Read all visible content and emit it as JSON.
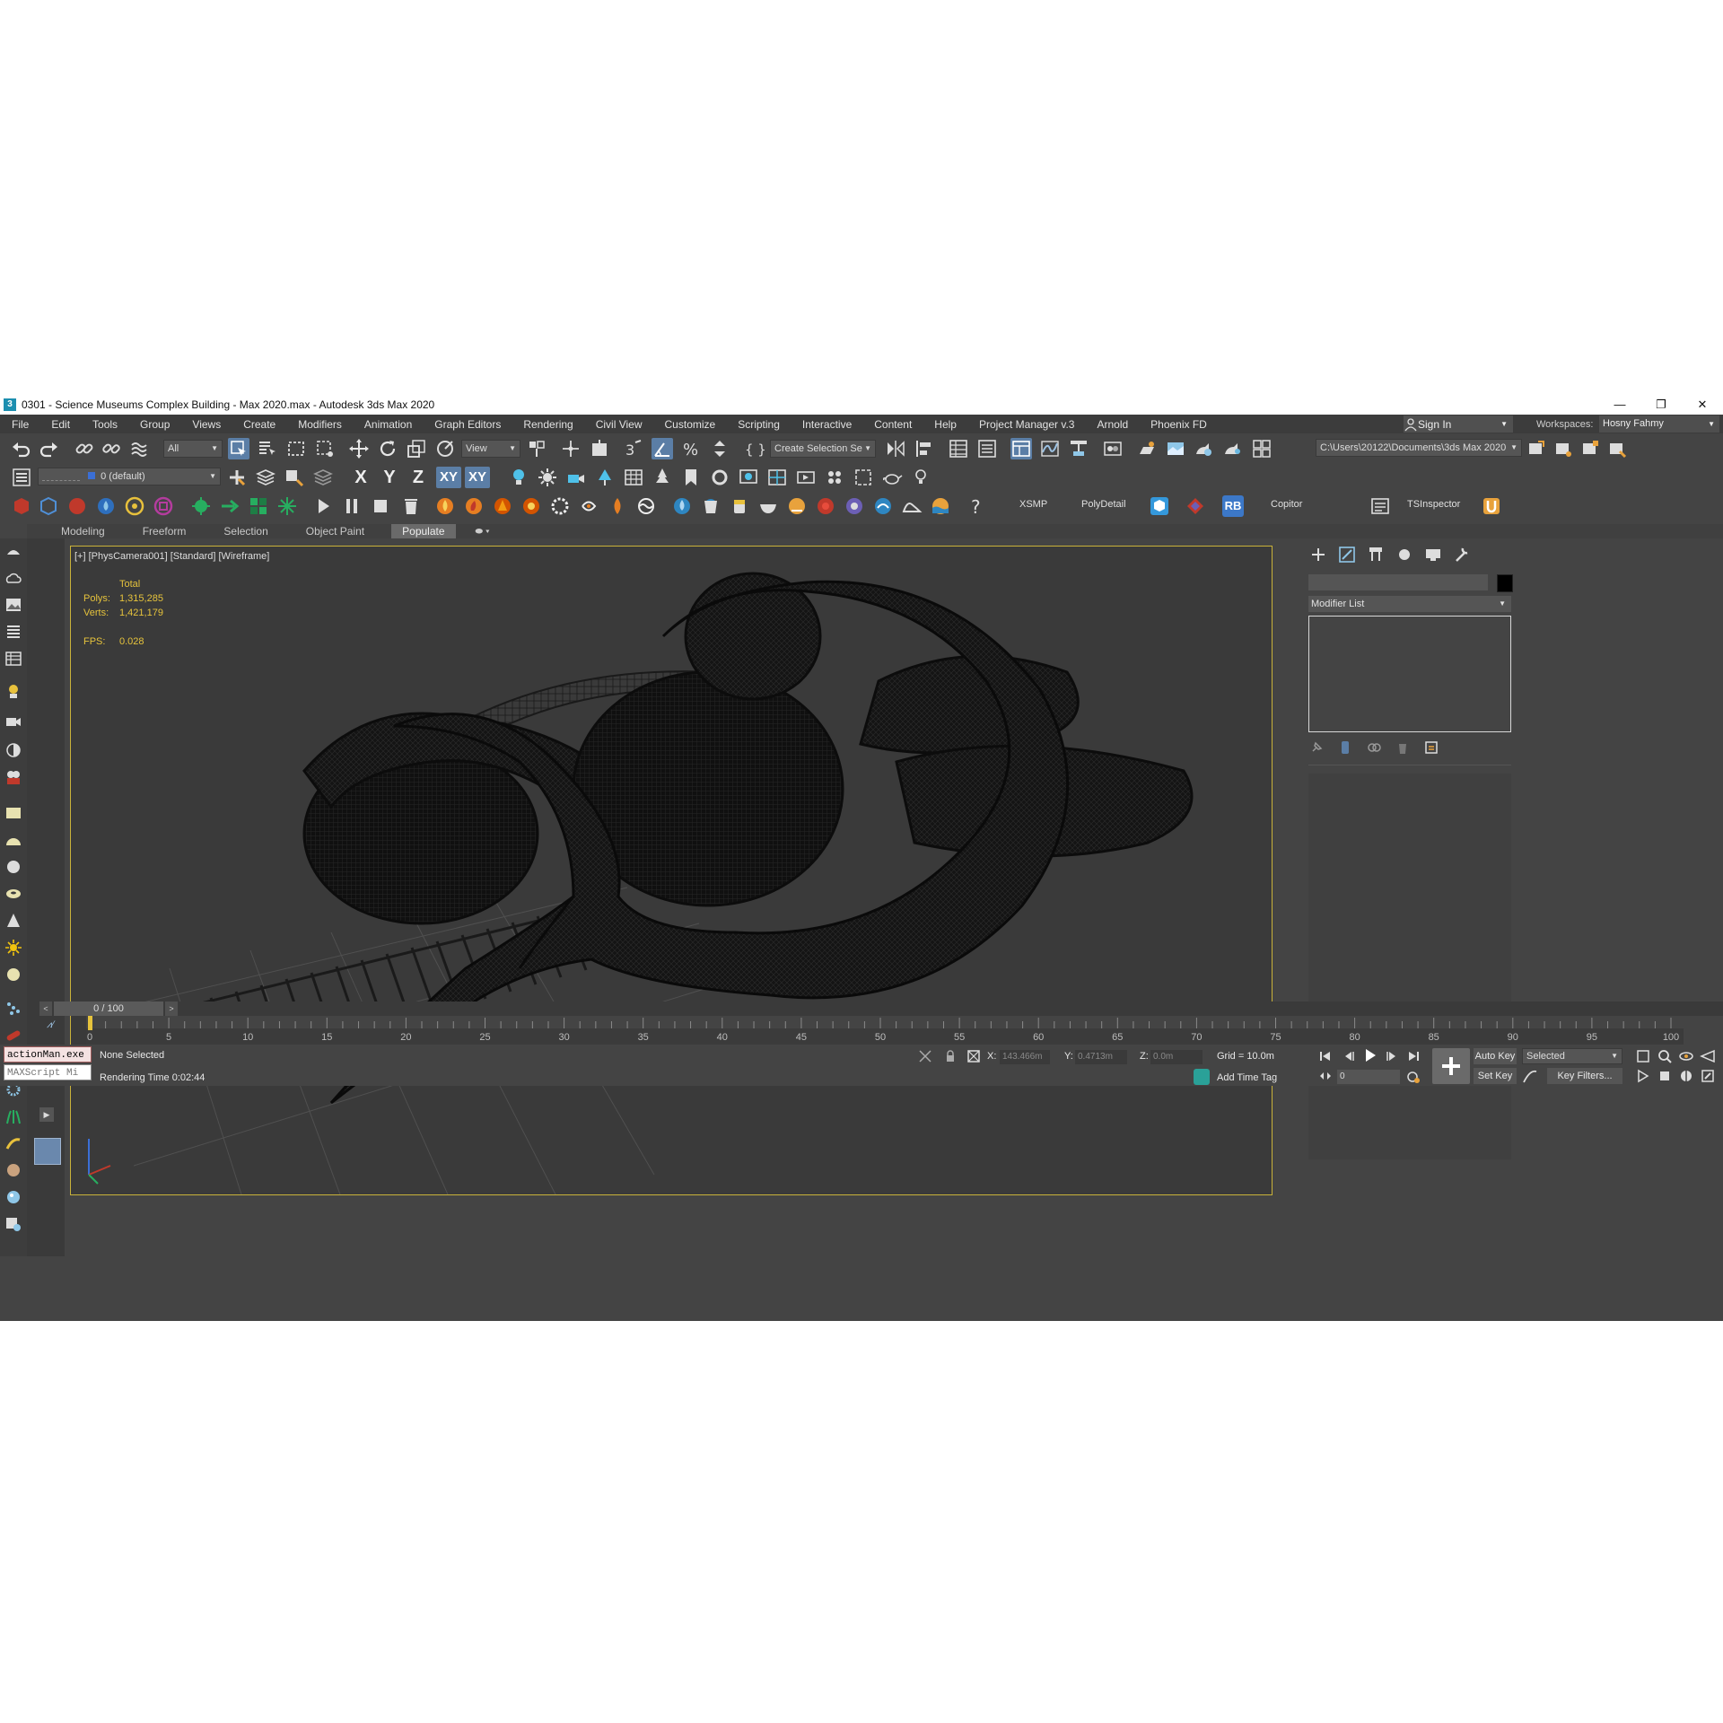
{
  "window": {
    "title": "0301 - Science Museums Complex Building - Max 2020.max - Autodesk 3ds Max 2020",
    "app_icon": "3",
    "controls": [
      "—",
      "❐",
      "✕"
    ]
  },
  "menu": [
    "File",
    "Edit",
    "Tools",
    "Group",
    "Views",
    "Create",
    "Modifiers",
    "Animation",
    "Graph Editors",
    "Rendering",
    "Civil View",
    "Customize",
    "Scripting",
    "Interactive",
    "Content",
    "Help",
    "Project Manager v.3",
    "Arnold",
    "Phoenix FD"
  ],
  "account": {
    "sign_in": "Sign In",
    "workspaces_label": "Workspaces:",
    "workspace": "Hosny Fahmy"
  },
  "toolbar": {
    "selection_filter": "All",
    "ref_coord": "View",
    "named_selection": "Create Selection Se",
    "project_path": "C:\\Users\\20122\\Documents\\3ds Max 2020",
    "layer": "0 (default)",
    "axis_x": "X",
    "axis_y": "Y",
    "axis_z": "Z",
    "axis_xy": "XY",
    "axis_xy2": "XY",
    "plugins": [
      "XSMP",
      "PolyDetail",
      "RB",
      "Copitor",
      "TSInspector"
    ]
  },
  "ribbon": {
    "tabs": [
      "Modeling",
      "Freeform",
      "Selection",
      "Object Paint",
      "Populate"
    ],
    "selected": "Populate"
  },
  "viewport": {
    "label": "[+] [PhysCamera001] [Standard] [Wireframe]",
    "stats_header": "Total",
    "polys_label": "Polys:",
    "polys": "1,315,285",
    "verts_label": "Verts:",
    "verts": "1,421,179",
    "fps_label": "FPS:",
    "fps": "0.028"
  },
  "command_panel": {
    "modifier_list": "Modifier List",
    "swatch_color": "#000000"
  },
  "timeline": {
    "slider": "0 / 100",
    "current_frame_fraction": 0.0,
    "ticks": [
      "0",
      "5",
      "10",
      "15",
      "20",
      "25",
      "30",
      "35",
      "40",
      "45",
      "50",
      "55",
      "60",
      "65",
      "70",
      "75",
      "80",
      "85",
      "90",
      "95",
      "100"
    ]
  },
  "status": {
    "maxscript_1": "actionMan.exe",
    "maxscript_2": "MAXScript Mi",
    "selection": "None Selected",
    "render_time": "Rendering Time  0:02:44",
    "x_label": "X:",
    "x": "143.466m",
    "y_label": "Y:",
    "y": "0.4713m",
    "z_label": "Z:",
    "z": "0.0m",
    "grid": "Grid = 10.0m",
    "add_time_tag": "Add Time Tag",
    "auto_key": "Auto Key",
    "set_key": "Set Key",
    "key_mode": "Selected",
    "key_filters": "Key Filters...",
    "frame": "0"
  },
  "colors": {
    "accent": "#5b7ea6",
    "viewport_border": "#c9b23a",
    "stats": "#e6c33c",
    "ui_bg": "#444444"
  }
}
